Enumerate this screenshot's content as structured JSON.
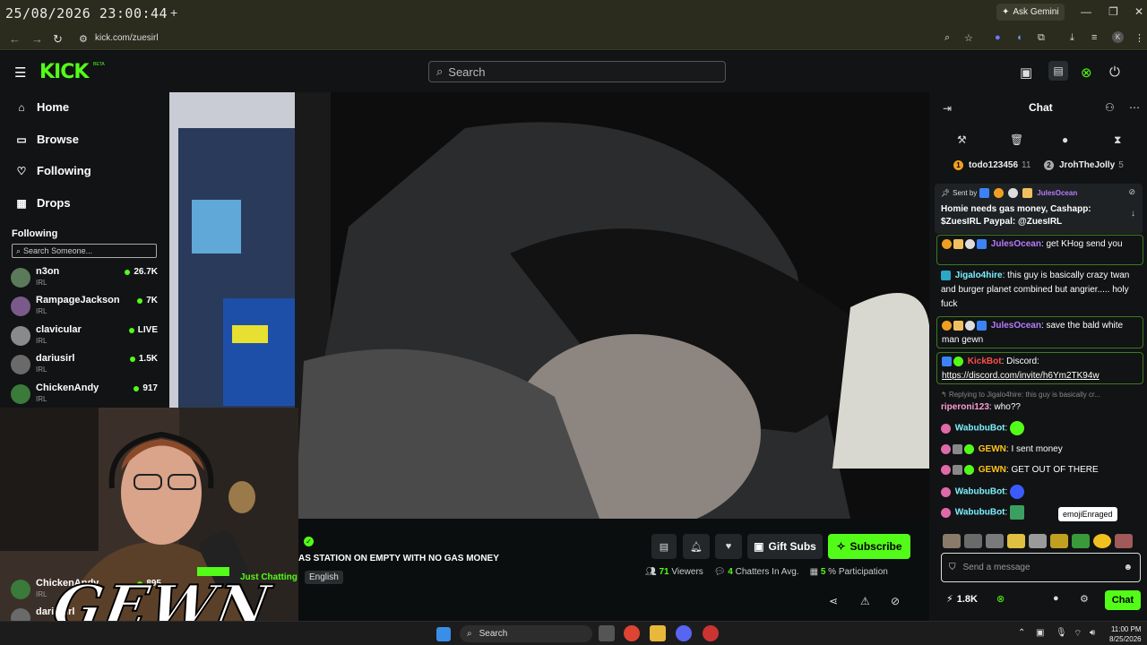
{
  "browser": {
    "overlay_clock": "25/08/2026 23:00:44",
    "new_tab": "+",
    "ask_gemini": "Ask Gemini",
    "url": "kick.com/zuesirl",
    "profile_initial": "K"
  },
  "header": {
    "logo": "KICK",
    "beta": "BETA",
    "search_placeholder": "Search"
  },
  "sidebar": {
    "nav": [
      {
        "label": "Home",
        "icon": "home-icon"
      },
      {
        "label": "Browse",
        "icon": "browse-icon"
      },
      {
        "label": "Following",
        "icon": "heart-icon"
      },
      {
        "label": "Drops",
        "icon": "drops-icon"
      }
    ],
    "following_heading": "Following",
    "search_placeholder": "Search Someone...",
    "channels": [
      {
        "name": "n3on",
        "category": "IRL",
        "viewers": "26.7K",
        "color": "#5a7a5a"
      },
      {
        "name": "RampageJackson",
        "category": "IRL",
        "viewers": "7K",
        "color": "#7a5a8a"
      },
      {
        "name": "clavicular",
        "category": "IRL",
        "viewers": "LIVE",
        "color": "#8a8a8a"
      },
      {
        "name": "dariusirl",
        "category": "IRL",
        "viewers": "1.5K",
        "color": "#6a6a6a"
      },
      {
        "name": "ChickenAndy",
        "category": "IRL",
        "viewers": "917",
        "color": "#3a7a3a"
      },
      {
        "name": "ChickenAndy",
        "category": "IRL",
        "viewers": "895",
        "color": "#3a7a3a"
      },
      {
        "name": "dariusirl",
        "category": "IRL",
        "viewers": "",
        "color": "#6a6a6a"
      }
    ]
  },
  "stream": {
    "title": "AS STATION ON EMPTY WITH NO GAS MONEY",
    "category": "Just Chatting",
    "language": "English",
    "gift_subs": "Gift Subs",
    "subscribe": "Subscribe",
    "viewers_num": "71",
    "viewers_label": "Viewers",
    "chatters_num": "4",
    "chatters_label": "Chatters In Avg.",
    "participation_num": "5",
    "participation_label": "% Participation",
    "overlay_text": "GEWN"
  },
  "chat": {
    "title": "Chat",
    "leaderboard": [
      {
        "rank": "1",
        "name": "todo123456",
        "count": "11"
      },
      {
        "rank": "2",
        "name": "JrohTheJolly",
        "count": "5"
      }
    ],
    "pinned": {
      "sent_by": "Sent by",
      "user": "JulesOcean",
      "message": "Homie needs gas money, Cashapp: $ZuesIRL Paypal: @ZuesIRL"
    },
    "messages": [
      {
        "user": "JulesOcean",
        "text": "get KHog send you",
        "color": "#b77bff"
      },
      {
        "user": "Jigalo4hire",
        "text": "this guy is basically crazy twan and burger planet combined but angrier..... holy fuck",
        "color": "#7cf0ff"
      },
      {
        "user": "JulesOcean",
        "text": "save the bald white man gewn",
        "color": "#b77bff"
      },
      {
        "user": "KickBot",
        "text": "Discord:",
        "link": "https://discord.com/invite/h6Ym2TK94w",
        "color": "#ff4d4d"
      },
      {
        "reply": "Replying to Jigalo4hire: this guy is basically cr..."
      },
      {
        "user": "riperoni123",
        "text": "who??",
        "color": "#ff9bd5"
      },
      {
        "user": "WabubuBot",
        "text": "",
        "color": "#7cf0ff"
      },
      {
        "user": "GEWN",
        "text": "I sent money",
        "color": "#ffc21a"
      },
      {
        "user": "GEWN",
        "text": "GET OUT OF THERE",
        "color": "#ffc21a"
      },
      {
        "user": "WabubuBot",
        "text": "",
        "color": "#7cf0ff"
      },
      {
        "user": "WabubuBot",
        "text": "",
        "color": "#7cf0ff"
      }
    ],
    "tooltip": "emojiEnraged",
    "input_placeholder": "Send a message",
    "kicks": "1.8K",
    "send_label": "Chat"
  },
  "taskbar": {
    "search": "Search",
    "time": "11:00 PM",
    "date": "8/25/2026"
  },
  "colors": {
    "accent": "#53fc18",
    "background": "#0b0e0f",
    "panel": "#111314"
  }
}
